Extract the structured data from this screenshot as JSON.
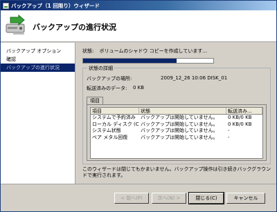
{
  "window": {
    "title": "バックアップ（1 回限り）ウィザード"
  },
  "header": {
    "title": "バックアップの進行状況"
  },
  "sidebar": {
    "items": [
      {
        "label": "バックアップ オプション"
      },
      {
        "label": "確認"
      },
      {
        "label": "バックアップの進行状況"
      }
    ],
    "active_index": 2
  },
  "status": {
    "label": "状態:",
    "text": "ボリュームのシャドウ コピーを作成しています...",
    "progress_fraction": 0.72
  },
  "details": {
    "group_label": "状態の詳細",
    "location_label": "バックアップの場所:",
    "location_value": "2009_12_26 10:06 DISK_01",
    "transferred_label": "転送済みのデータ:",
    "transferred_value": "0 KB",
    "tab_label": "項目",
    "table": {
      "headers": [
        "項目",
        "状態",
        "転送済み..."
      ],
      "rows": [
        [
          "システムで予約済み",
          "バックアップは開始していません。",
          "0 KB/0 KB"
        ],
        [
          "ローカル ディスク (C:)",
          "バックアップは開始していません。",
          "0 KB/0 KB"
        ],
        [
          "システム状態",
          "バックアップは開始していません。",
          "-"
        ],
        [
          "ベア メタル回復",
          "バックアップは開始していません。",
          "-"
        ]
      ]
    }
  },
  "footnote": "このウィザードは閉じてもかまいません。バックアップ操作は引き続きバックグラウンドで実行されます。",
  "buttons": {
    "back": "< 前へ(P)",
    "next": "次へ(N) >",
    "close": "閉じる(C)",
    "cancel": "キャンセル"
  }
}
